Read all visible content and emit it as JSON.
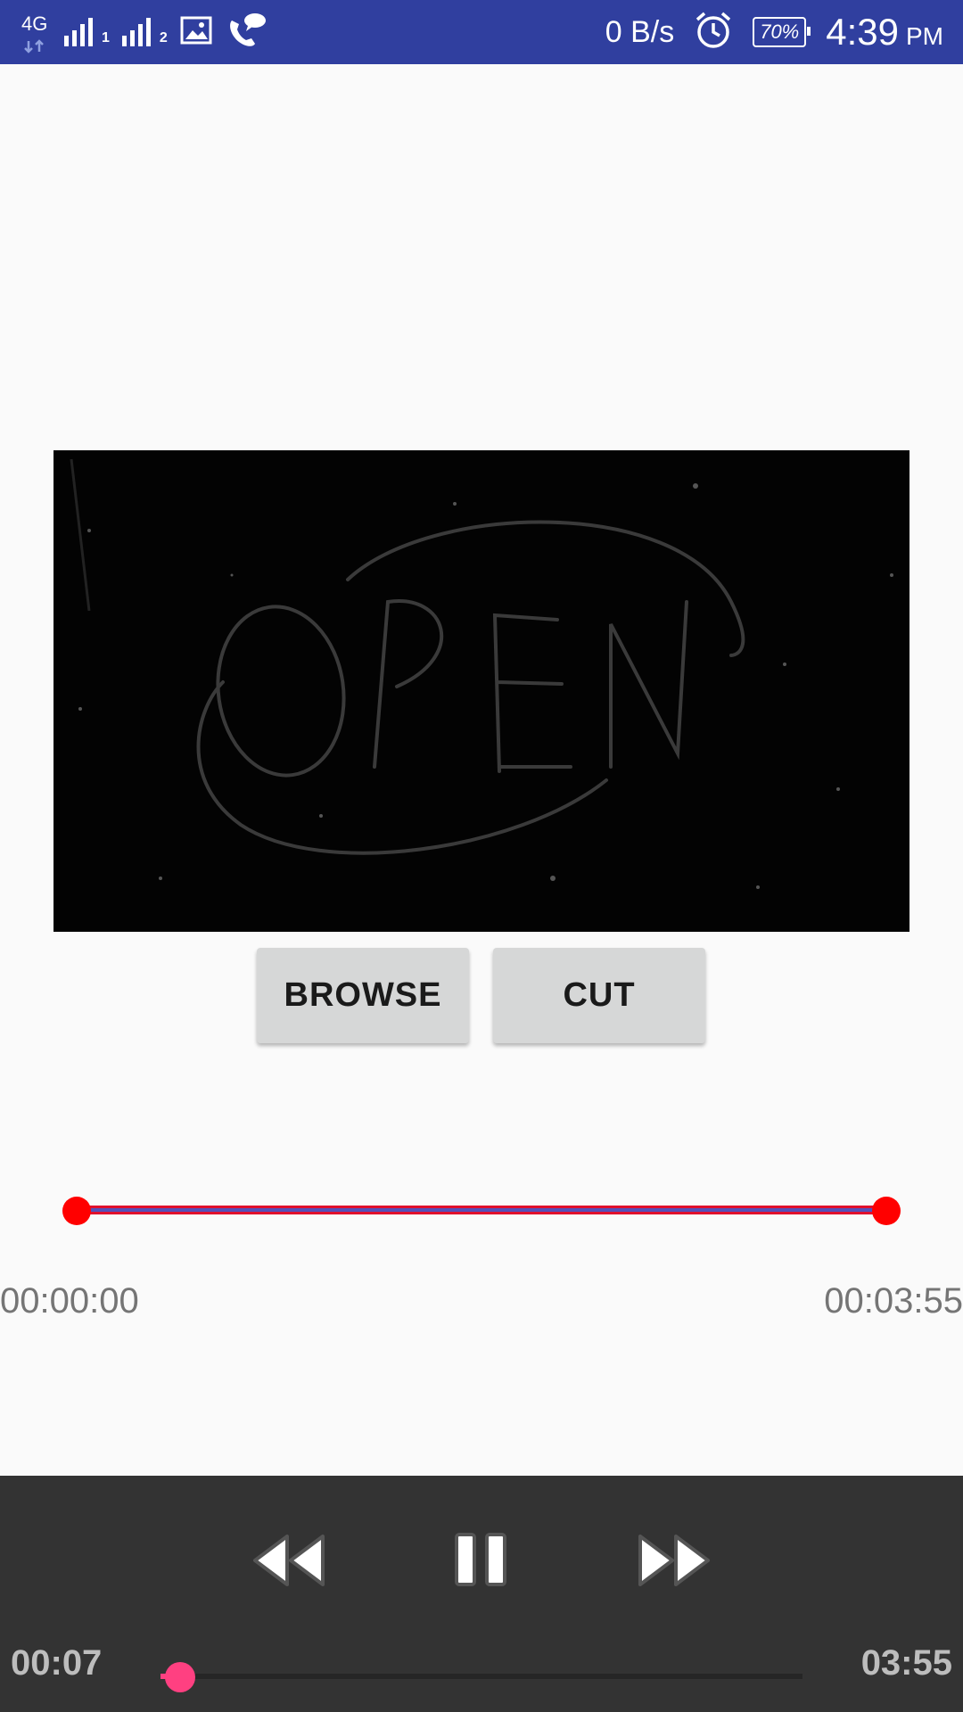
{
  "status_bar": {
    "network_type": "4G",
    "sim1_index": "1",
    "sim2_index": "2",
    "data_speed": "0 B/s",
    "battery": "70%",
    "time": "4:39",
    "ampm": "PM",
    "background_color": "#303f9f"
  },
  "buttons": {
    "browse": "BROWSE",
    "cut": "CUT"
  },
  "video": {
    "preview_text": "OPEN"
  },
  "range": {
    "start_time": "00:00:00",
    "end_time": "00:03:55",
    "min_fraction": 0.0,
    "max_fraction": 1.0,
    "thumb_color": "#ff0000"
  },
  "player": {
    "current_time": "00:07",
    "duration": "03:55",
    "progress_fraction": 0.03,
    "accent_color": "#ff4081",
    "icons": [
      "rewind-icon",
      "pause-icon",
      "fast-forward-icon"
    ]
  }
}
